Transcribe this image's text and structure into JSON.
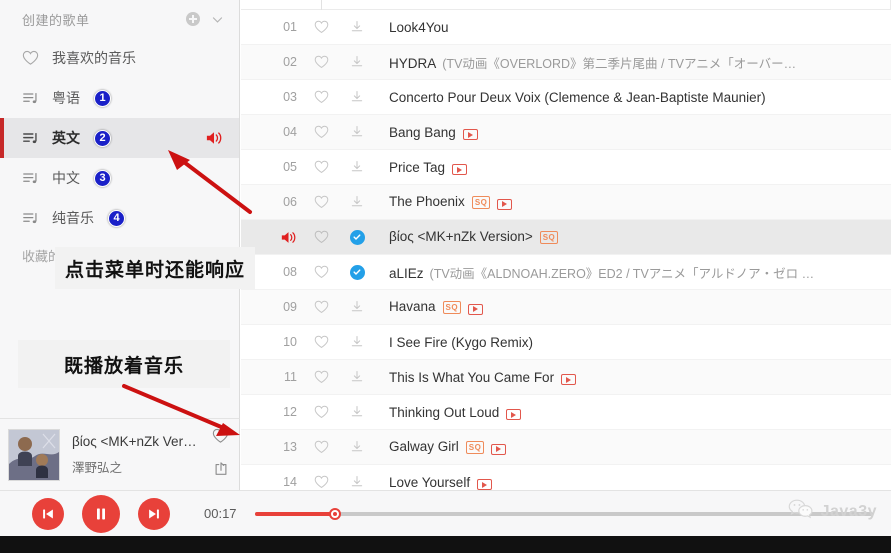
{
  "sidebar": {
    "header": {
      "title": "创建的歌单",
      "add_icon": "plus-circle-icon",
      "collapse_icon": "chevron-down-icon"
    },
    "items": [
      {
        "label": "我喜欢的音乐",
        "icon": "heart-icon",
        "badge": "",
        "active": false,
        "speaker": false
      },
      {
        "label": "粤语",
        "icon": "playlist-note-icon",
        "badge": "1",
        "active": false,
        "speaker": false
      },
      {
        "label": "英文",
        "icon": "playlist-note-icon",
        "badge": "2",
        "active": true,
        "speaker": true
      },
      {
        "label": "中文",
        "icon": "playlist-note-icon",
        "badge": "3",
        "active": false,
        "speaker": false
      },
      {
        "label": "纯音乐",
        "icon": "playlist-note-icon",
        "badge": "4",
        "active": false,
        "speaker": false
      }
    ],
    "footer_label": "收藏的"
  },
  "tracklist": {
    "rows": [
      {
        "index": "01",
        "title": "Look4You",
        "subtitle": "",
        "sq": false,
        "mv": false,
        "downloaded": false,
        "playing": false
      },
      {
        "index": "02",
        "title": "HYDRA",
        "subtitle": "(TV动画《OVERLORD》第二季片尾曲 / TVアニメ「オーバー…",
        "sq": false,
        "mv": false,
        "downloaded": false,
        "playing": false
      },
      {
        "index": "03",
        "title": "Concerto Pour Deux Voix (Clemence & Jean-Baptiste Maunier)",
        "subtitle": "",
        "sq": false,
        "mv": false,
        "downloaded": false,
        "playing": false
      },
      {
        "index": "04",
        "title": "Bang Bang",
        "subtitle": "",
        "sq": false,
        "mv": true,
        "downloaded": false,
        "playing": false
      },
      {
        "index": "05",
        "title": "Price Tag",
        "subtitle": "",
        "sq": false,
        "mv": true,
        "downloaded": false,
        "playing": false
      },
      {
        "index": "06",
        "title": "The Phoenix",
        "subtitle": "",
        "sq": true,
        "mv": true,
        "downloaded": false,
        "playing": false
      },
      {
        "index": "07",
        "title": "βίος <MK+nZk Version>",
        "subtitle": "",
        "sq": true,
        "mv": false,
        "downloaded": true,
        "playing": true
      },
      {
        "index": "08",
        "title": "aLIEz",
        "subtitle": "(TV动画《ALDNOAH.ZERO》ED2 / TVアニメ「アルドノア・ゼロ …",
        "sq": false,
        "mv": false,
        "downloaded": true,
        "playing": false
      },
      {
        "index": "09",
        "title": "Havana",
        "subtitle": "",
        "sq": true,
        "mv": true,
        "downloaded": false,
        "playing": false
      },
      {
        "index": "10",
        "title": "I See Fire (Kygo Remix)",
        "subtitle": "",
        "sq": false,
        "mv": false,
        "downloaded": false,
        "playing": false
      },
      {
        "index": "11",
        "title": "This Is What You Came For",
        "subtitle": "",
        "sq": false,
        "mv": true,
        "downloaded": false,
        "playing": false
      },
      {
        "index": "12",
        "title": "Thinking Out Loud",
        "subtitle": "",
        "sq": false,
        "mv": true,
        "downloaded": false,
        "playing": false
      },
      {
        "index": "13",
        "title": "Galway Girl",
        "subtitle": "",
        "sq": true,
        "mv": true,
        "downloaded": false,
        "playing": false
      },
      {
        "index": "14",
        "title": "Love Yourself",
        "subtitle": "",
        "sq": false,
        "mv": true,
        "downloaded": false,
        "playing": false
      }
    ],
    "tag_sq_label": "SQ"
  },
  "now_playing": {
    "title": "βίος <MK+nZk Ver…",
    "artist": "澤野弘之",
    "like_icon": "heart-icon",
    "share_icon": "share-icon",
    "album_art": "album-art-thumbnail"
  },
  "player": {
    "prev_icon": "skip-previous-icon",
    "pause_icon": "pause-icon",
    "next_icon": "skip-next-icon",
    "current_time": "00:17",
    "progress_percent": 13
  },
  "watermark": {
    "label": "Java3y",
    "icon": "wechat-icon"
  },
  "annotations": [
    {
      "text": "点击菜单时还能响应"
    },
    {
      "text": "既播放着音乐"
    }
  ],
  "colors": {
    "accent_red": "#e8413a",
    "badge_blue": "#1a20c8",
    "download_blue": "#23a0e8",
    "sq_orange": "#ef8b5a",
    "active_bar": "#c62828"
  }
}
